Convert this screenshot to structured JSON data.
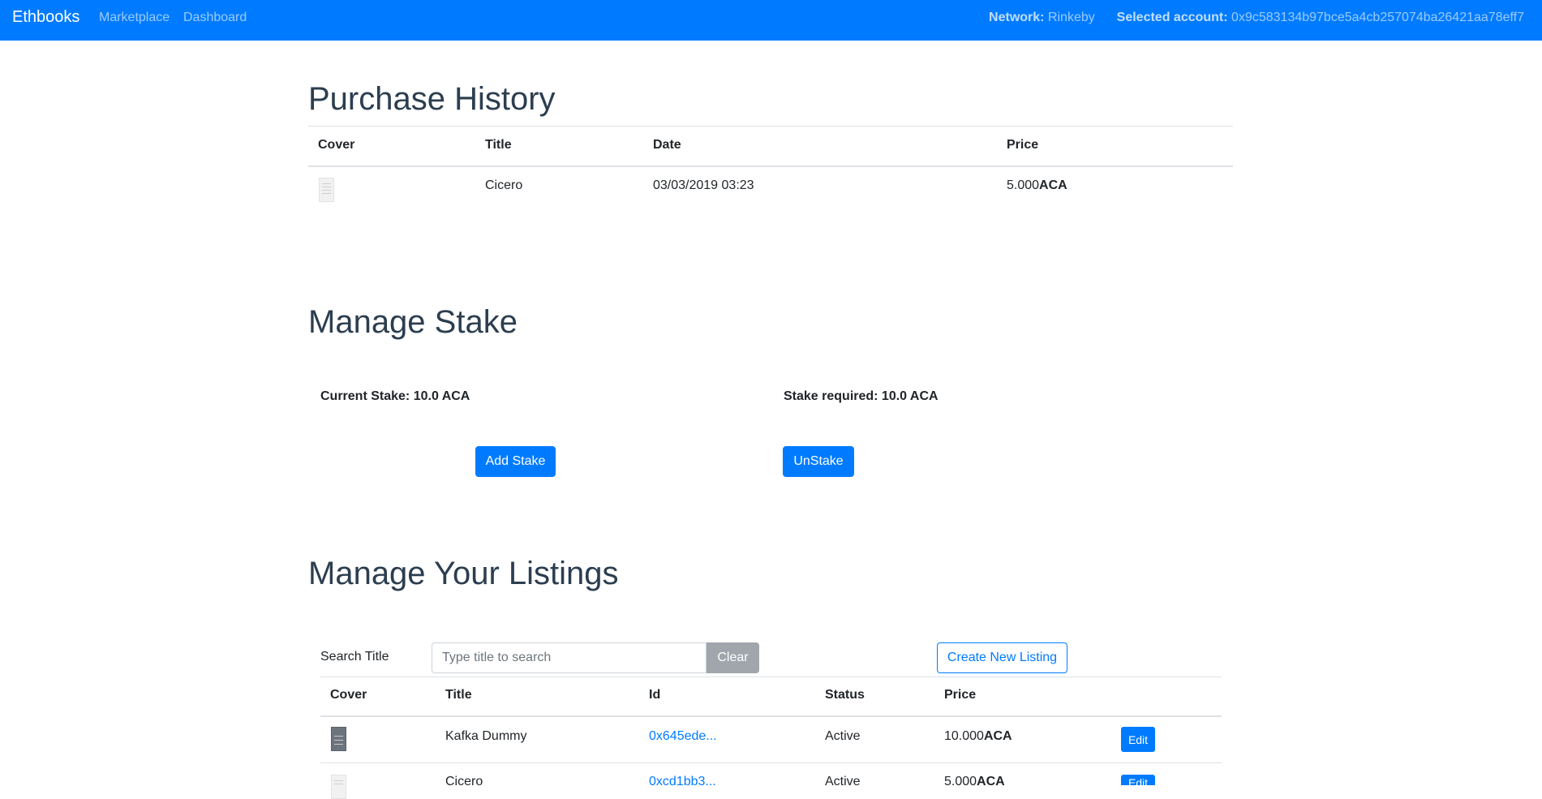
{
  "navbar": {
    "brand": "Ethbooks",
    "links": [
      "Marketplace",
      "Dashboard"
    ],
    "network_label": "Network:",
    "network_value": "Rinkeby",
    "account_label": "Selected account:",
    "account_value": "0x9c583134b97bce5a4cb257074ba26421aa78eff7"
  },
  "purchase_history": {
    "title": "Purchase History",
    "columns": [
      "Cover",
      "Title",
      "Date",
      "Price"
    ],
    "rows": [
      {
        "title": "Cicero",
        "date": "03/03/2019 03:23",
        "price": "5.000",
        "unit": "ACA"
      }
    ]
  },
  "stake": {
    "title": "Manage Stake",
    "current_label": "Current Stake: 10.0 ACA",
    "required_label": "Stake required: 10.0 ACA",
    "add_button": "Add Stake",
    "unstake_button": "UnStake"
  },
  "listings": {
    "title": "Manage Your Listings",
    "search_label": "Search Title",
    "search_placeholder": "Type title to search",
    "clear_button": "Clear",
    "create_button": "Create New Listing",
    "columns": [
      "Cover",
      "Title",
      "Id",
      "Status",
      "Price"
    ],
    "rows": [
      {
        "title": "Kafka Dummy",
        "id": "0x645ede...",
        "status": "Active",
        "price": "10.000",
        "unit": "ACA",
        "edit": "Edit"
      },
      {
        "title": "Cicero",
        "id": "0xcd1bb3...",
        "status": "Active",
        "price": "5.000",
        "unit": "ACA",
        "edit": "Edit"
      }
    ]
  },
  "colors": {
    "primary": "#007bff",
    "heading": "#2c3e50",
    "secondary_button": "#a0a6ac"
  }
}
